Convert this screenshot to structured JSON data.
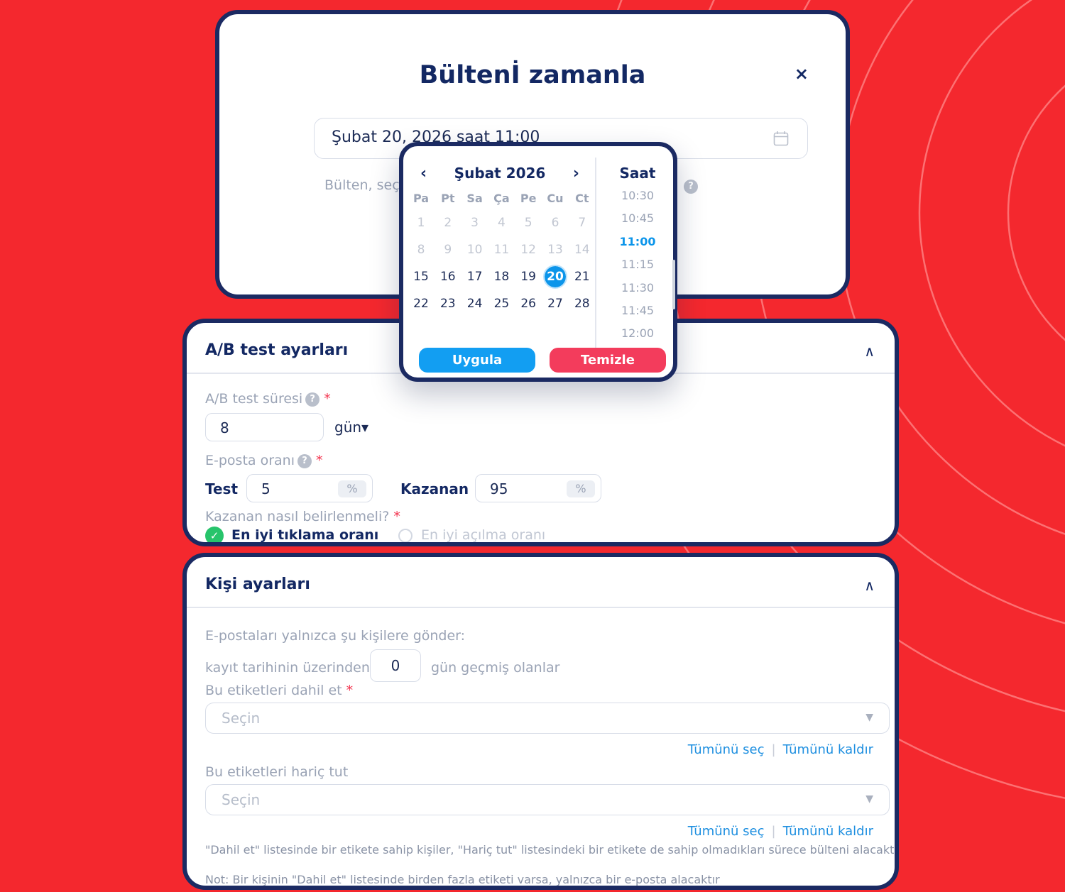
{
  "modal": {
    "title": "Bültenİ zamanla",
    "close": "×",
    "date_value": "Şubat 20, 2026 saat 11:00",
    "date_icon": "calendar-icon",
    "hint": "Bülten, seç"
  },
  "picker": {
    "month": "Şubat 2026",
    "prev": "‹",
    "next": "›",
    "weekdays": [
      "Pa",
      "Pt",
      "Sa",
      "Ça",
      "Pe",
      "Cu",
      "Ct"
    ],
    "weeks": [
      [
        "1",
        "2",
        "3",
        "4",
        "5",
        "6",
        "7"
      ],
      [
        "8",
        "9",
        "10",
        "11",
        "12",
        "13",
        "14"
      ],
      [
        "15",
        "16",
        "17",
        "18",
        "19",
        "20",
        "21"
      ],
      [
        "22",
        "23",
        "24",
        "25",
        "26",
        "27",
        "28"
      ]
    ],
    "selected_day": "20",
    "time_title": "Saat",
    "times": [
      "10:30",
      "10:45",
      "11:00",
      "11:15",
      "11:30",
      "11:45",
      "12:00"
    ],
    "selected_time": "11:00",
    "apply": "Uygula",
    "clear": "Temizle",
    "colors": {
      "accent": "#0c95ea",
      "clear": "#f33c5c"
    }
  },
  "ab": {
    "title": "A/B test ayarları",
    "chevron": "∧",
    "duration_label": "A/B test süresi",
    "duration_value": "8",
    "duration_unit": "gün▾",
    "ratio_label": "E-posta oranı",
    "test_label": "Test",
    "test_value": "5",
    "winner_label": "Kazanan",
    "winner_value": "95",
    "percent": "%",
    "how_label": "Kazanan nasıl belirlenmeli?",
    "option_click": "En iyi tıklama oranı",
    "option_open": "En iyi açılma oranı",
    "required": "*",
    "help": "?"
  },
  "kisi": {
    "title": "Kişi ayarları",
    "chevron": "∧",
    "send_label": "E-postaları yalnızca şu kişilere gönder:",
    "reg_prefix": "kayıt tarihinin üzerinden",
    "reg_value": "0",
    "reg_suffix": "gün geçmiş olanlar",
    "include_label": "Bu etiketleri dahil et",
    "exclude_label": "Bu etiketleri hariç tut",
    "select_placeholder": "Seçin",
    "select_all": "Tümünü seç",
    "remove_all": "Tümünü kaldır",
    "separator": "|",
    "note1": "\"Dahil et\" listesinde bir etikete sahip kişiler, \"Hariç tut\" listesindeki bir etikete de sahip olmadıkları sürece bülteni alacaktır",
    "note2": "Not: Bir kişinin \"Dahil et\" listesinde birden fazla etiketi varsa, yalnızca bir e-posta alacaktır",
    "required": "*"
  },
  "colors": {
    "background": "#f4282e",
    "border": "#1b2a62",
    "link": "#1e8fe0"
  }
}
